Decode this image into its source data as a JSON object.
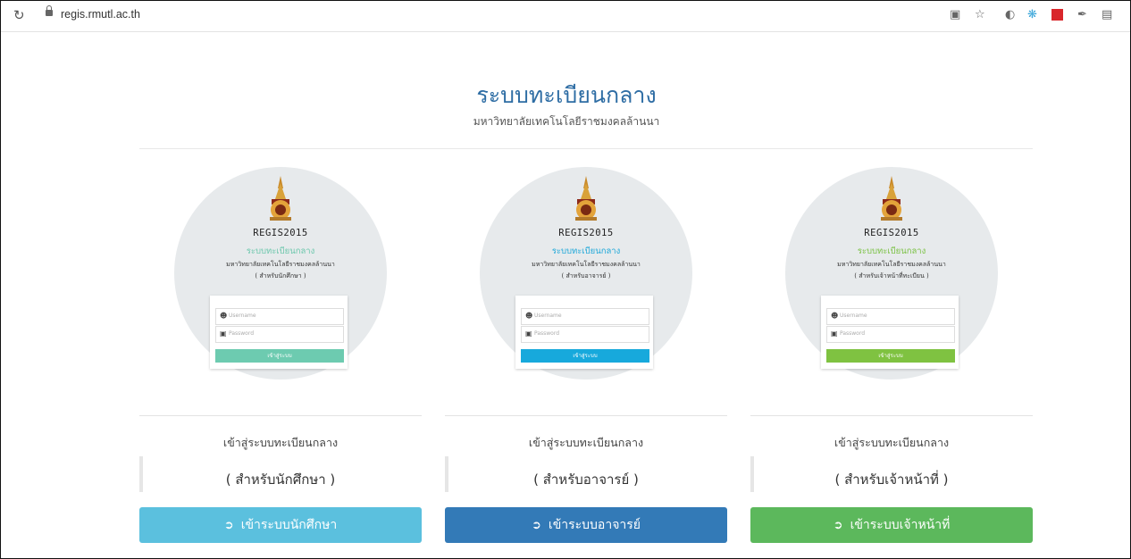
{
  "browser": {
    "url": "regis.rmutl.ac.th"
  },
  "header": {
    "title": "ระบบทะเบียนกลาง",
    "subtitle": "มหาวิทยาลัยเทคโนโลยีราชมงคลล้านนา"
  },
  "columns": [
    {
      "regis": "REGIS2015",
      "sys": "ระบบทะเบียนกลาง",
      "uni": "มหาวิทยาลัยเทคโนโลยีราชมงคลล้านนา",
      "for_small": "( สำหรับนักศึกษา )",
      "username_placeholder": "Username",
      "password_placeholder": "Password",
      "login_label": "เข้าสู่ระบบ",
      "enter_label": "เข้าสู่ระบบทะเบียนกลาง",
      "for_label": "( สำหรับนักศึกษา )",
      "button_label": "เข้าระบบนักศึกษา",
      "sys_color": "#6cc7ac",
      "login_color": "#6dcbb0",
      "button_color": "#5bc0de"
    },
    {
      "regis": "REGIS2015",
      "sys": "ระบบทะเบียนกลาง",
      "uni": "มหาวิทยาลัยเทคโนโลยีราชมงคลล้านนา",
      "for_small": "( สำหรับอาจารย์ )",
      "username_placeholder": "Username",
      "password_placeholder": "Password",
      "login_label": "เข้าสู่ระบบ",
      "enter_label": "เข้าสู่ระบบทะเบียนกลาง",
      "for_label": "( สำหรับอาจารย์ )",
      "button_label": "เข้าระบบอาจารย์",
      "sys_color": "#1fa8d9",
      "login_color": "#17a9dc",
      "button_color": "#337ab7"
    },
    {
      "regis": "REGIS2015",
      "sys": "ระบบทะเบียนกลาง",
      "uni": "มหาวิทยาลัยเทคโนโลยีราชมงคลล้านนา",
      "for_small": "( สำหรับเจ้าหน้าที่ทะเบียน )",
      "username_placeholder": "Username",
      "password_placeholder": "Password",
      "login_label": "เข้าสู่ระบบ",
      "enter_label": "เข้าสู่ระบบทะเบียนกลาง",
      "for_label": "( สำหรับเจ้าหน้าที่ )",
      "button_label": "เข้าระบบเจ้าหน้าที่",
      "sys_color": "#7ac143",
      "login_color": "#7fc241",
      "button_color": "#5cb85c"
    }
  ]
}
